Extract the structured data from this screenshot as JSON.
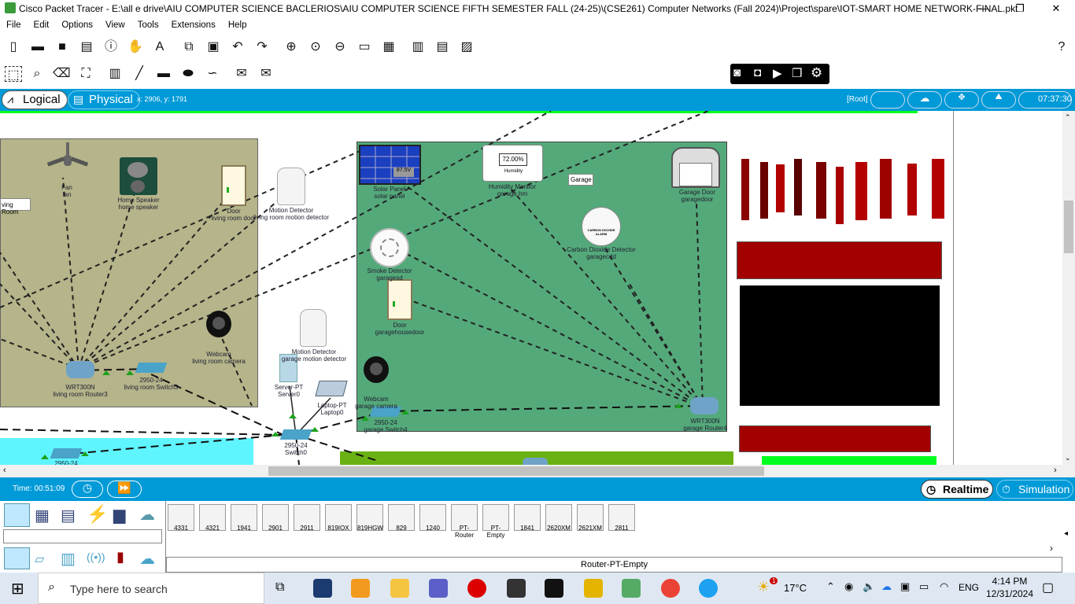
{
  "window": {
    "title": "Cisco Packet Tracer - E:\\all e drive\\AIU COMPUTER SCIENCE BACLERIOS\\AIU COMPUTER SCIENCE FIFTH SEMESTER FALL (24-25)\\(CSE261) Computer Networks (Fall 2024)\\Project\\spare\\IOT-SMART HOME NETWORK-FINAL.pkt",
    "minimize": "—",
    "maximize": "❐",
    "close": "✕"
  },
  "menu": [
    "File",
    "Edit",
    "Options",
    "View",
    "Tools",
    "Extensions",
    "Help"
  ],
  "help_glyph": "?",
  "modes": {
    "logical": "Logical",
    "physical": "Physical",
    "coords": "x: 2906, y: 1791",
    "root": "[Root]",
    "clock": "07:37:30"
  },
  "canvas": {
    "rooms": {
      "living": "ving Room",
      "garage": "Garage"
    },
    "devices": [
      {
        "id": "fan",
        "line1": "Fan",
        "line2": "fan"
      },
      {
        "id": "homespeaker",
        "line1": "Home Speaker",
        "line2": "home speaker"
      },
      {
        "id": "lrdoor",
        "line1": "Door",
        "line2": "living room door"
      },
      {
        "id": "lrmotion",
        "line1": "Motion Detector",
        "line2": "living room motion detector"
      },
      {
        "id": "lrwebcam",
        "line1": "Webcam",
        "line2": "living room camera"
      },
      {
        "id": "router3",
        "line1": "WRT300N",
        "line2": "living room Router3"
      },
      {
        "id": "switch3",
        "line1": "2950-24",
        "line2": "living room Switch3"
      },
      {
        "id": "gmotion",
        "line1": "Motion Detector",
        "line2": "garage motion detector"
      },
      {
        "id": "server",
        "line1": "Server-PT",
        "line2": "Server0"
      },
      {
        "id": "laptop",
        "line1": "Laptop-PT",
        "line2": "Laptop0"
      },
      {
        "id": "switch0",
        "line1": "2950-24",
        "line2": "Switch0"
      },
      {
        "id": "solar",
        "line1": "Solar Panel",
        "line2": "solar panel"
      },
      {
        "id": "humidity",
        "line1": "Humidity Monitor",
        "line2": "garage hm"
      },
      {
        "id": "garagedoor",
        "line1": "Garage Door",
        "line2": "garagedoor"
      },
      {
        "id": "co",
        "line1": "Carbon Dioxide Detector",
        "line2": "garagecdd"
      },
      {
        "id": "smoke",
        "line1": "Smoke Detector",
        "line2": "garagesd"
      },
      {
        "id": "ghdoor",
        "line1": "Door",
        "line2": "garagehousedoor"
      },
      {
        "id": "gwebcam",
        "line1": "Webcam",
        "line2": "garage camera"
      },
      {
        "id": "switch4",
        "line1": "2950-24",
        "line2": "garage Switch4"
      },
      {
        "id": "router4",
        "line1": "WRT300N",
        "line2": "garage Router4"
      },
      {
        "id": "sw_bottom",
        "line1": "2950-24",
        "line2": ""
      }
    ],
    "solar_text": "87.5V",
    "humidity_text": "72.00%",
    "humidity_caption": "Humidity",
    "co_caption": "CARBON DIOXIDE ALARM"
  },
  "status": {
    "time": "Time: 00:51:09",
    "realtime": "Realtime",
    "simulation": "Simulation"
  },
  "device_models": [
    "4331",
    "4321",
    "1941",
    "2901",
    "2911",
    "819IOX",
    "819HGW",
    "829",
    "1240",
    "PT-Router",
    "PT-Empty",
    "1841",
    "2620XM",
    "2621XM",
    "2811"
  ],
  "selected_model": "Router-PT-Empty",
  "taskbar": {
    "search_placeholder": "Type here to search",
    "weather": "17°C",
    "lang": "ENG",
    "time": "4:14 PM",
    "date": "12/31/2024",
    "notif_badge": "1"
  },
  "colors": {
    "accent": "#009ad8",
    "living_room": "#b5b48a",
    "garage": "#54a97a",
    "dark_red": "#a30000",
    "black_box": "#000000",
    "green_bar": "#00ff1e"
  }
}
